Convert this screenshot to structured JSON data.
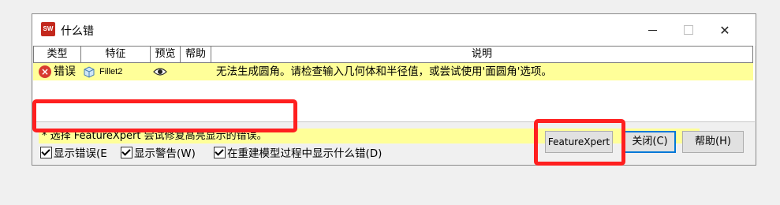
{
  "window": {
    "title": "什么错",
    "app_icon_text": "SW"
  },
  "grid": {
    "columns": [
      "类型",
      "特征",
      "预览",
      "帮助",
      "说明"
    ],
    "rows": [
      {
        "type": "错误",
        "feature": "Fillet2",
        "description": "无法生成圆角。请检查输入几何体和半径值，或尝试使用'面圆角'选项。"
      }
    ]
  },
  "hint": "* 选择 FeatureXpert 尝试修复高亮显示的错误。",
  "options": {
    "show_errors": "显示错误(E",
    "show_warnings": "显示警告(W)",
    "show_during_rebuild": "在重建模型过程中显示什么错(D)"
  },
  "buttons": {
    "featurexpert": "FeatureXpert",
    "close": "关闭(C)",
    "help": "帮助(H)"
  },
  "colors": {
    "highlight_row": "#ffff99",
    "annotation": "#ff1f1f",
    "error": "#d83b2f"
  }
}
